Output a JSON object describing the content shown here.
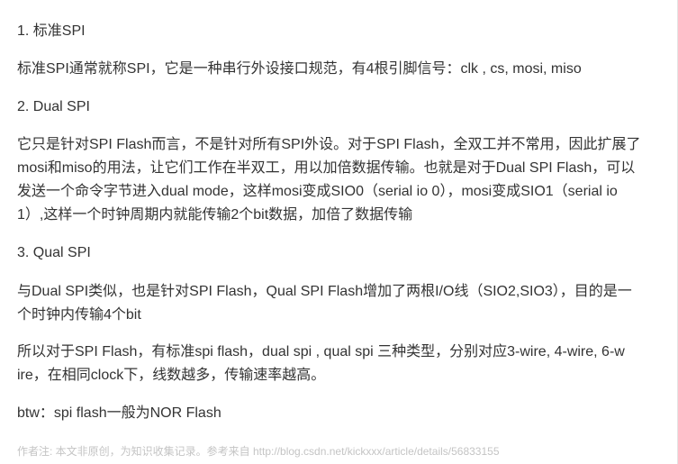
{
  "article": {
    "sections": [
      {
        "heading": "1. 标准SPI",
        "paragraphs": [
          [
            "标准SPI通常就称SPI，它是一种串行外设接口规范，有4根引脚信号：clk , cs, mosi, miso"
          ]
        ]
      },
      {
        "heading": "2. Dual SPI",
        "paragraphs": [
          [
            "它只是针对SPI Flash而言，不是针对所有SPI外设。对于SPI Flash，全双工并不常用，因此扩展了",
            "mosi和miso的用法，让它们工作在半双工，用以加倍数据传输。也就是对于Dual SPI Flash，可以",
            "发送一个命令字节进入dual mode，这样mosi变成SIO0（serial io 0），mosi变成SIO1（serial io",
            "1）,这样一个时钟周期内就能传输2个bit数据，加倍了数据传输"
          ]
        ]
      },
      {
        "heading": "3. Qual SPI",
        "paragraphs": [
          [
            "与Dual SPI类似，也是针对SPI Flash，Qual SPI Flash增加了两根I/O线（SIO2,SIO3），目的是一",
            "个时钟内传输4个bit"
          ],
          [
            "所以对于SPI Flash，有标准spi flash，dual spi , qual spi 三种类型，分别对应3-wire, 4-wire, 6-w",
            "ire，在相同clock下，线数越多，传输速率越高。"
          ],
          [
            "btw：spi flash一般为NOR Flash"
          ]
        ]
      }
    ],
    "footer_note": "作者注: 本文非原创，为知识收集记录。参考来自 http://blog.csdn.net/kickxxx/article/details/56833155"
  }
}
